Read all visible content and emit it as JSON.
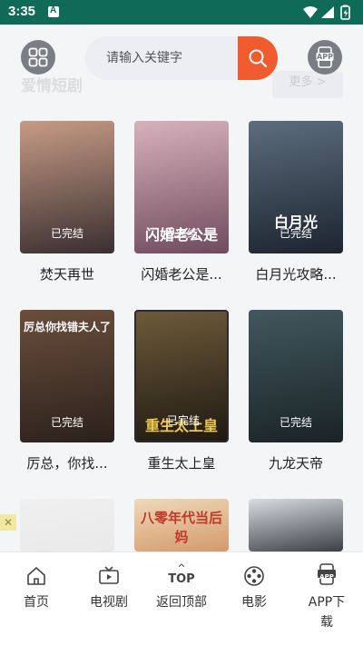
{
  "status_bar": {
    "time": "3:35",
    "notification_letter": "A"
  },
  "header": {
    "search_placeholder": "请输入关键字",
    "app_badge": "APP"
  },
  "section": {
    "title": "爱情短剧",
    "more": "更多 >"
  },
  "status_label": "已完结",
  "cards": [
    {
      "title": "焚天再世",
      "status": "已完结",
      "caption": "",
      "colors": [
        "#c79b85",
        "#3a2f31"
      ]
    },
    {
      "title": "闪婚老公是...",
      "status": "已完结",
      "caption": "闪婚老公是",
      "colors": [
        "#d7b2bd",
        "#6f4b5c"
      ]
    },
    {
      "title": "白月光攻略...",
      "status": "已完结",
      "caption": "白月光",
      "colors": [
        "#5c6d7d",
        "#1c2430"
      ]
    },
    {
      "title": "厉总，你找...",
      "status": "已完结",
      "caption": "厉总你找错夫人了",
      "colors": [
        "#6b4e3c",
        "#2a211c"
      ]
    },
    {
      "title": "重生太上皇",
      "status": "已完结",
      "caption": "重生太上皇",
      "colors": [
        "#6d5a3a",
        "#1f1a12"
      ]
    },
    {
      "title": "九龙天帝",
      "status": "已完结",
      "caption": "",
      "colors": [
        "#41585e",
        "#1a2326"
      ]
    }
  ],
  "partial_cards": [
    {
      "caption": "",
      "colors": [
        "#f0f0f0",
        "#e9e9e9"
      ]
    },
    {
      "caption": "八零年代当后妈",
      "colors": [
        "#efd9b9",
        "#d39a6a"
      ]
    },
    {
      "caption": "",
      "colors": [
        "#d9dde2",
        "#3a3f46"
      ]
    }
  ],
  "ad_mark": "✕",
  "bottom_nav": [
    {
      "label": "首页",
      "icon": "home-icon"
    },
    {
      "label": "电视剧",
      "icon": "tv-icon"
    },
    {
      "label": "返回顶部",
      "icon": "top-icon",
      "icon_text": "TOP"
    },
    {
      "label": "电影",
      "icon": "film-reel-icon"
    },
    {
      "label": "APP下载",
      "icon": "app-download-icon",
      "icon_text": "APP"
    }
  ]
}
